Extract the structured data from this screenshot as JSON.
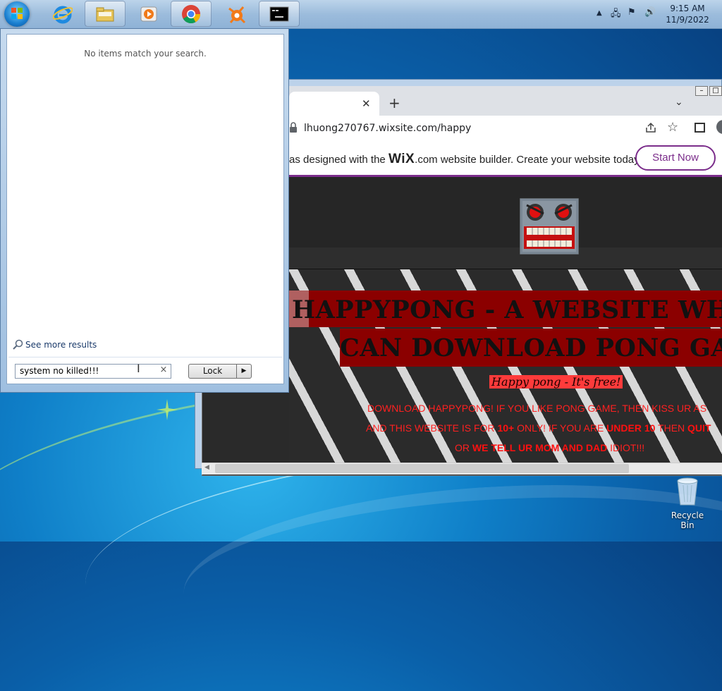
{
  "taskbar": {
    "items": [
      {
        "name": "internet-explorer"
      },
      {
        "name": "file-explorer"
      },
      {
        "name": "media-player"
      },
      {
        "name": "google-chrome"
      },
      {
        "name": "avast"
      },
      {
        "name": "command-prompt"
      }
    ],
    "clock": {
      "time": "9:15 AM",
      "date": "11/9/2022"
    }
  },
  "start_menu": {
    "no_results": "No items match your search.",
    "see_more": "See more results",
    "search_value": "system no killed!!!",
    "lock_label": "Lock"
  },
  "browser": {
    "url": "lhuong270767.wixsite.com/happy",
    "wix_banner_prefix": "as designed with the",
    "wix_logo": "WiX",
    "wix_banner_suffix": ".com website builder. Create your website today.",
    "start_now": "Start Now"
  },
  "site": {
    "title_line1": "HAPPYPONG - A WEBSITE WHER",
    "title_line2": "CAN DOWNLOAD PONG GAM",
    "subtitle": "Happy pong - It's free!",
    "line1": "DOWNLOAD HAPPYPONG! IF YOU LIKE PONG GAME, THEN KISS UR AS",
    "line2_a": "AND THIS WEBSITE IS FOR ",
    "line2_b": "10+",
    "line2_c": " ONLY! IF YOU ARE ",
    "line2_d": "UNDER 10",
    "line2_e": " THEN ",
    "line2_f": "QUIT",
    "line3_a": "OR ",
    "line3_b": "WE TELL UR MOM AND DAD",
    "line3_c": " IDIOT!!!"
  },
  "desktop": {
    "recycle_bin": "Recycle Bin"
  },
  "colors": {
    "accent": "#7b2d8b",
    "title_bg": "#8b0000",
    "text_red": "#ff2020"
  }
}
